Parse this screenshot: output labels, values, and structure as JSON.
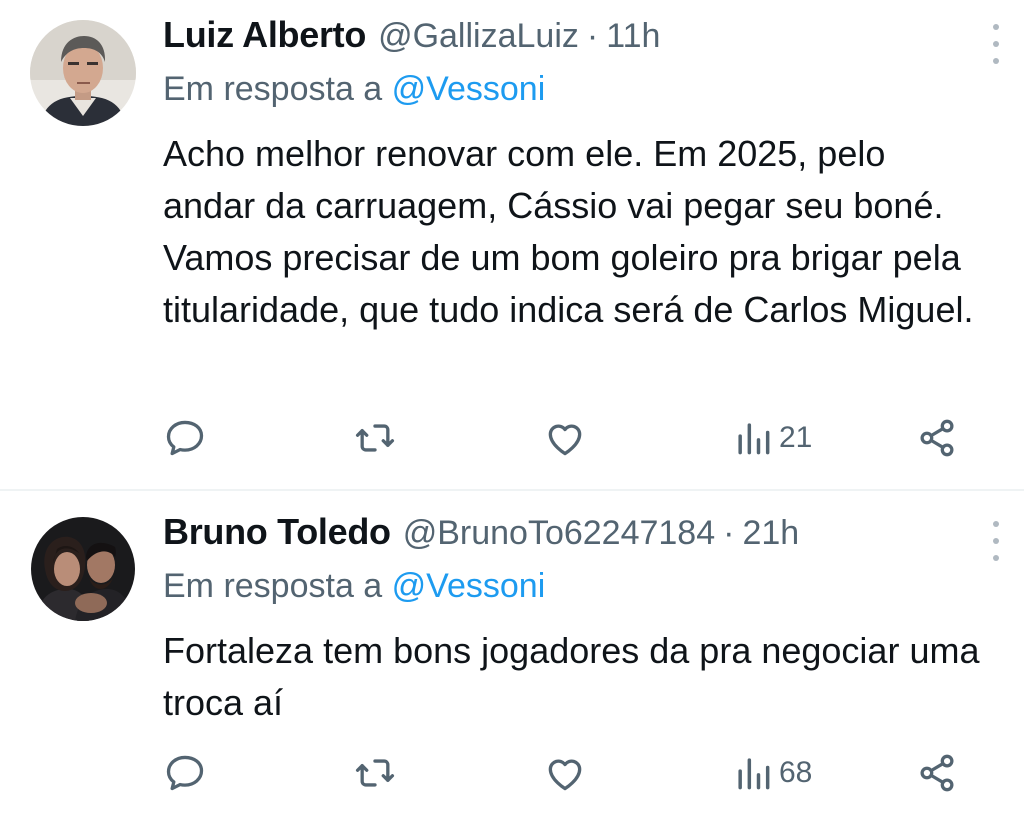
{
  "tweets": [
    {
      "name": "Luiz Alberto",
      "handle": "@GallizaLuiz",
      "separator": "·",
      "time": "11h",
      "reply_prefix": "Em resposta a",
      "reply_mention": "@Vessoni",
      "text": "Acho melhor renovar com ele. Em 2025, pelo andar da carruagem, Cássio vai pegar seu boné. Vamos precisar de um bom goleiro pra brigar pela titularidade, que tudo indica será de Carlos Miguel.",
      "views": "21",
      "icons": [
        "reply-icon",
        "retweet-icon",
        "like-icon",
        "views-icon",
        "share-icon",
        "more-icon"
      ]
    },
    {
      "name": "Bruno Toledo",
      "handle": "@BrunoTo62247184",
      "separator": "·",
      "time": "21h",
      "reply_prefix": "Em resposta a",
      "reply_mention": "@Vessoni",
      "text": "Fortaleza tem bons jogadores da pra negociar uma troca aí",
      "views": "68",
      "icons": [
        "reply-icon",
        "retweet-icon",
        "like-icon",
        "views-icon",
        "share-icon",
        "more-icon"
      ]
    }
  ],
  "colors": {
    "text": "#0f1419",
    "secondary": "#536471",
    "link": "#1d9bf0",
    "divider": "#eff3f4"
  }
}
